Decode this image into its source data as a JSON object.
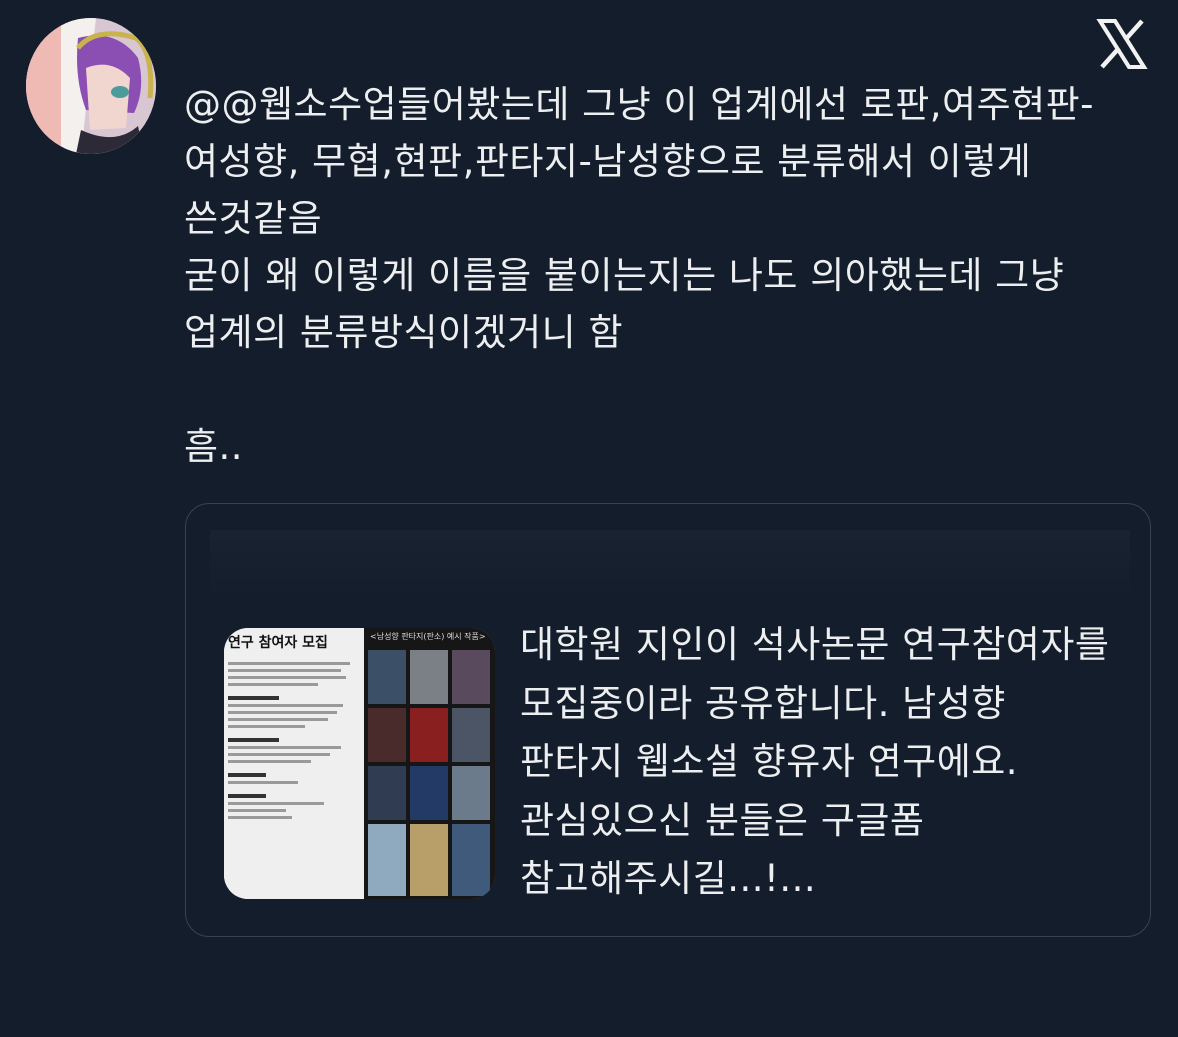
{
  "tweet": {
    "text": "@@웹소수업들어봤는데 그냥 이 업계에선 로판,여주현판-여성향, 무협,현판,판타지-남성향으로 분류해서 이렇게 쓴것같음\n굳이 왜 이렇게 이름을 붙이는지는 나도 의아했는데 그냥 업계의 분류방식이겠거니 함\n\n흠..",
    "avatar_icon": "profile-avatar",
    "logo_icon": "x-logo-icon"
  },
  "quote": {
    "text": "대학원 지인이 석사논문 연구참여자를 모집중이라 공유합니다. 남성향 판타지 웹소설 향유자 연구에요. 관심있으신 분들은 구글폼 참고해주시길...!...",
    "thumbnail": {
      "title": "연구 참여자 모집",
      "caption": "<남성향 판타지(판소) 예시 작품>"
    }
  },
  "colors": {
    "background": "#141d2b",
    "text": "#eceef0",
    "card_border": "#3a4250"
  }
}
